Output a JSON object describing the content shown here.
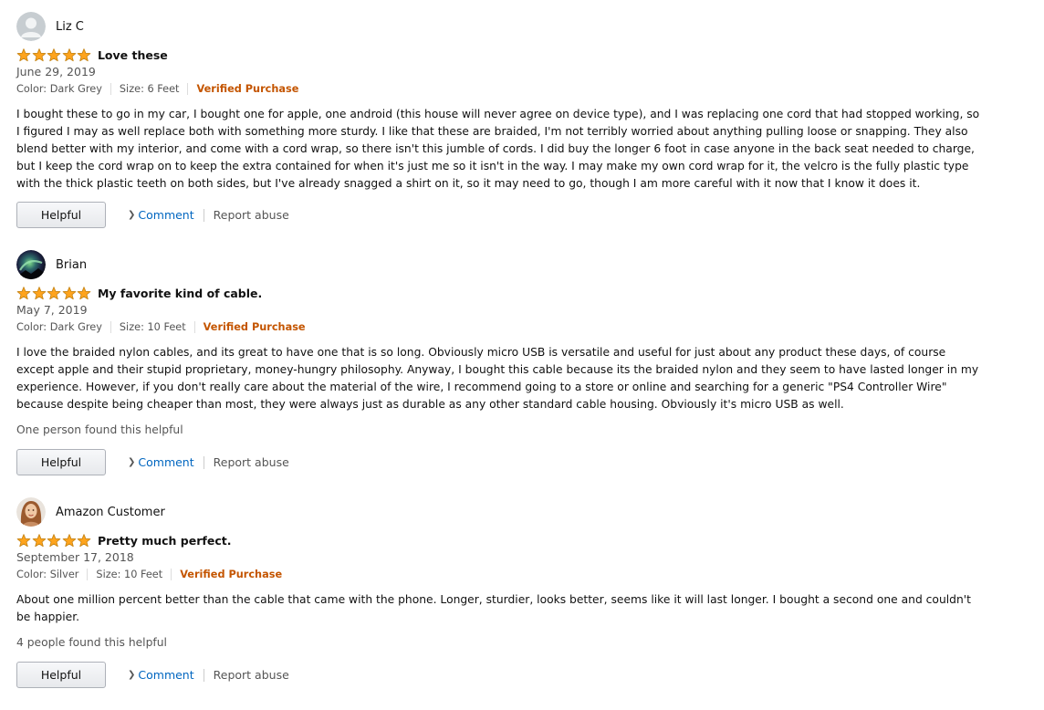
{
  "colors": {
    "star": "#ffa41c",
    "link": "#0066c0",
    "verified": "#c45500"
  },
  "rating": {
    "max": 5
  },
  "reviews": [
    {
      "name": "Liz C",
      "avatar": "default-avatar-icon",
      "rating": 5,
      "title": "Love these",
      "date": "June 29, 2019",
      "color": "Color: Dark Grey",
      "size": "Size: 6 Feet",
      "verified": "Verified Purchase",
      "body": "I bought these to go in my car, I bought one for apple, one android (this house will never agree on device type), and I was replacing one cord that had stopped working, so I figured I may as well replace both with something more sturdy. I like that these are braided, I'm not terribly worried about anything pulling loose or snapping. They also blend better with my interior, and come with a cord wrap, so there isn't this jumble of cords. I did buy the longer 6 foot in case anyone in the back seat needed to charge, but I keep the cord wrap on to keep the extra contained for when it's just me so it isn't in the way. I may make my own cord wrap for it, the velcro is the fully plastic type with the thick plastic teeth on both sides, but I've already snagged a shirt on it, so it may need to go, though I am more careful with it now that I know it does it.",
      "helpful_count": "",
      "helpful_label": "Helpful",
      "comment_label": "Comment",
      "report_label": "Report abuse"
    },
    {
      "name": "Brian",
      "avatar": "aurora-photo-avatar",
      "rating": 5,
      "title": "My favorite kind of cable.",
      "date": "May 7, 2019",
      "color": "Color: Dark Grey",
      "size": "Size: 10 Feet",
      "verified": "Verified Purchase",
      "body": "I love the braided nylon cables, and its great to have one that is so long. Obviously micro USB is versatile and useful for just about any product these days, of course except apple and their stupid proprietary, money-hungry philosophy. Anyway, I bought this cable because its the braided nylon and they seem to have lasted longer in my experience. However, if you don't really care about the material of the wire, I recommend going to a store or online and searching for a generic \"PS4 Controller Wire\" because despite being cheaper than most, they were always just as durable as any other standard cable housing. Obviously it's micro USB as well.",
      "helpful_count": "One person found this helpful",
      "helpful_label": "Helpful",
      "comment_label": "Comment",
      "report_label": "Report abuse"
    },
    {
      "name": "Amazon Customer",
      "avatar": "portrait-photo-avatar",
      "rating": 5,
      "title": "Pretty much perfect.",
      "date": "September 17, 2018",
      "color": "Color: Silver",
      "size": "Size: 10 Feet",
      "verified": "Verified Purchase",
      "body": "About one million percent better than the cable that came with the phone. Longer, sturdier, looks better, seems like it will last longer. I bought a second one and couldn't be happier.",
      "helpful_count": "4 people found this helpful",
      "helpful_label": "Helpful",
      "comment_label": "Comment",
      "report_label": "Report abuse"
    }
  ]
}
